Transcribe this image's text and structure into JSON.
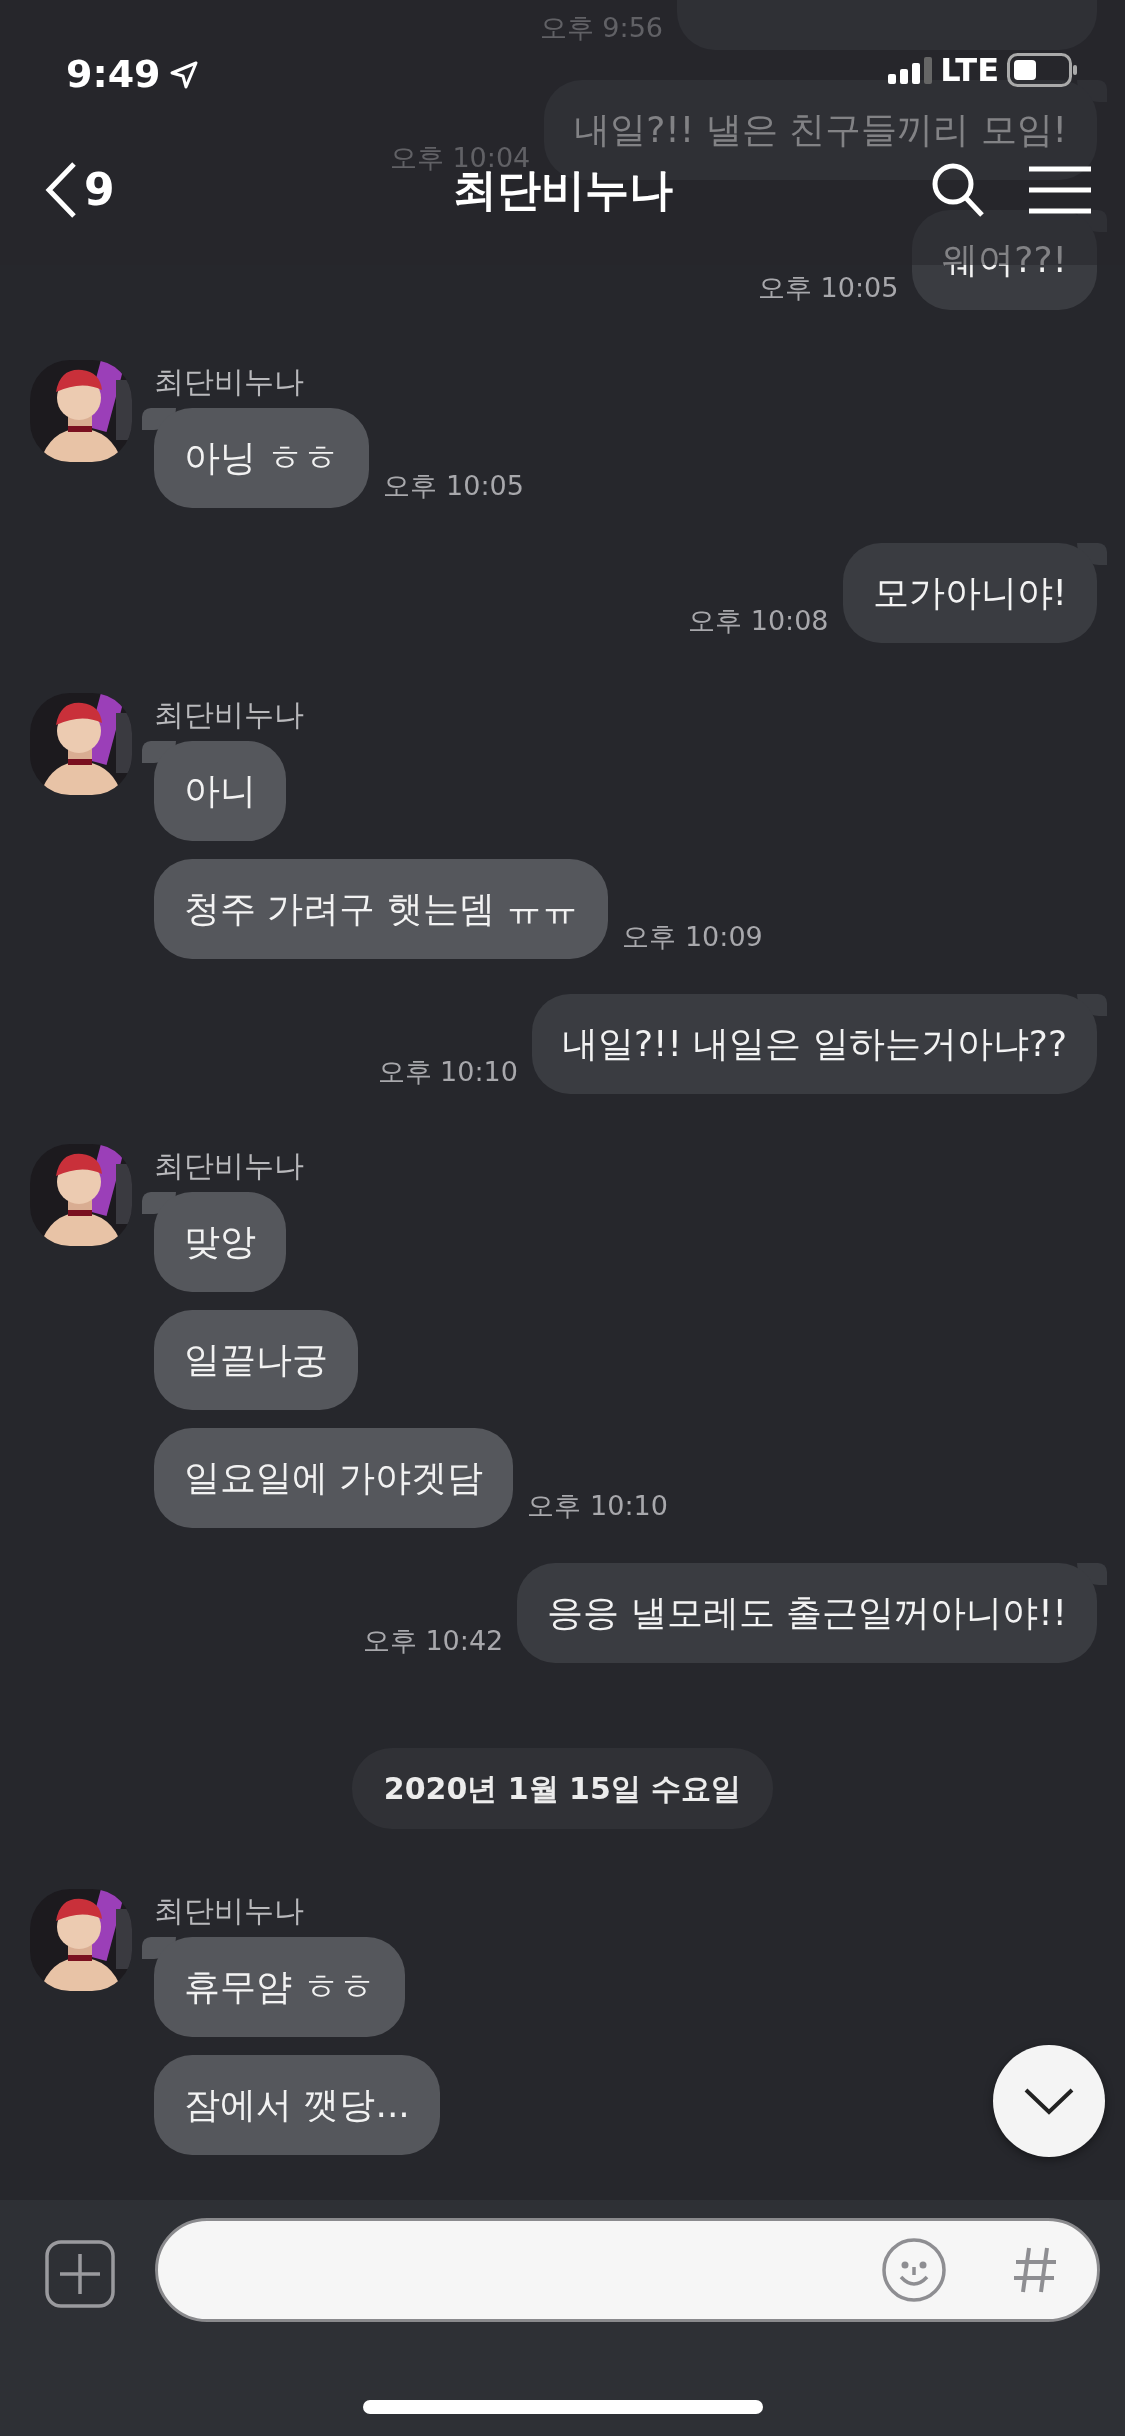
{
  "status_bar": {
    "time": "9:49",
    "network": "LTE"
  },
  "header": {
    "back_count": "9",
    "title": "최단비누나"
  },
  "messages": [
    {
      "kind": "sent",
      "time": "오후 9:56"
    },
    {
      "kind": "sent",
      "text": "내일?!! 낼은 친구들끼리 모임!",
      "time": "오후 10:04"
    },
    {
      "kind": "sent",
      "text": "웨여??!",
      "time": "오후 10:05"
    },
    {
      "kind": "received",
      "sender": "최단비누나",
      "bubbles": [
        {
          "text": "아닝 ㅎㅎ",
          "time": "오후 10:05"
        }
      ]
    },
    {
      "kind": "sent",
      "text": "모가아니야!",
      "time": "오후 10:08"
    },
    {
      "kind": "received",
      "sender": "최단비누나",
      "bubbles": [
        {
          "text": "아니"
        },
        {
          "text": "청주 가려구 햇는뎀 ㅠㅠ",
          "time": "오후 10:09"
        }
      ]
    },
    {
      "kind": "sent",
      "text": "내일?!! 내일은 일하는거아냐??",
      "time": "오후 10:10"
    },
    {
      "kind": "received",
      "sender": "최단비누나",
      "bubbles": [
        {
          "text": "맞앙"
        },
        {
          "text": "일끝나궁"
        },
        {
          "text": "일요일에 가야겟담",
          "time": "오후 10:10"
        }
      ]
    },
    {
      "kind": "sent",
      "text": "응응 낼모레도 출근일꺼아니야!!",
      "time": "오후 10:42"
    },
    {
      "kind": "date",
      "text": "2020년 1월 15일 수요일"
    },
    {
      "kind": "received",
      "sender": "최단비누나",
      "bubbles": [
        {
          "text": "휴무얌 ㅎㅎ"
        },
        {
          "text": "잠에서 깻당..."
        }
      ]
    }
  ]
}
